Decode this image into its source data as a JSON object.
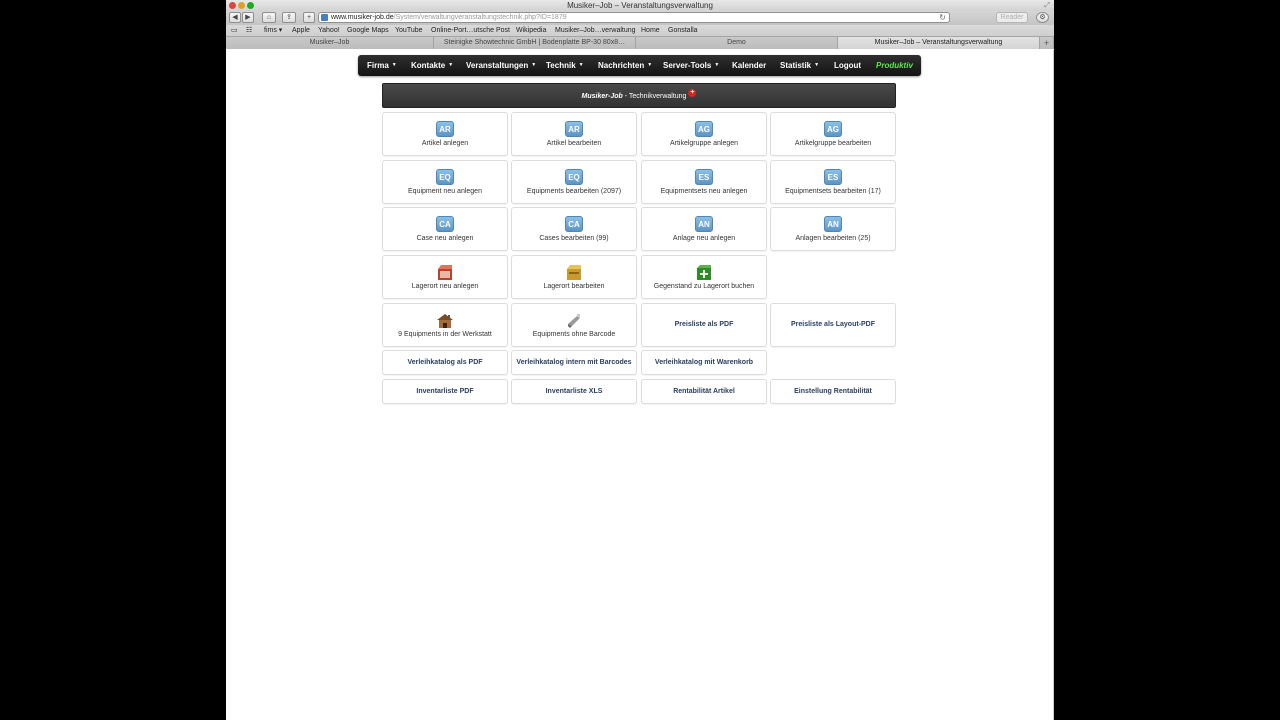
{
  "window": {
    "title": "Musiker–Job – Veranstaltungsverwaltung"
  },
  "toolbar": {
    "url_host": "www.musiker-job.de",
    "url_path": "/System/verwaltungveranstaltungstechnik.php?ID=1879",
    "reader_label": "Reader"
  },
  "bookmarks": [
    "fims ▾",
    "Apple",
    "Yahoo!",
    "Google Maps",
    "YouTube",
    "Online-Port…utsche Post",
    "Wikipedia",
    "Musiker–Job…verwaltung",
    "Home",
    "Gonstalla"
  ],
  "tabs": [
    {
      "label": "Musiker–Job"
    },
    {
      "label": "Steinigke Showtechnic GmbH | Bodenplatte BP-30 80x8…"
    },
    {
      "label": "Demo"
    },
    {
      "label": "Musiker–Job – Veranstaltungsverwaltung"
    }
  ],
  "nav": {
    "items": [
      "Firma",
      "Kontakte",
      "Veranstaltungen",
      "Technik",
      "Nachrichten",
      "Server-Tools",
      "Kalender",
      "Statistik",
      "Logout"
    ],
    "productive": "Produktiv"
  },
  "header": {
    "brand": "Musiker-Job",
    "title": " - Technikverwaltung",
    "plus": "+"
  },
  "tiles": [
    {
      "badge": "AR",
      "label": "Artikel anlegen"
    },
    {
      "badge": "AR",
      "label": "Artikel bearbeiten"
    },
    {
      "badge": "AG",
      "label": "Artikelgruppe anlegen"
    },
    {
      "badge": "AG",
      "label": "Artikelgruppe bearbeiten"
    },
    {
      "badge": "EQ",
      "label": "Equipment neu anlegen"
    },
    {
      "badge": "EQ",
      "label": "Equipments bearbeiten (2097)"
    },
    {
      "badge": "ES",
      "label": "Equipmentsets neu anlegen"
    },
    {
      "badge": "ES",
      "label": "Equipmentsets bearbeiten (17)"
    },
    {
      "badge": "CA",
      "label": "Case neu anlegen"
    },
    {
      "badge": "CA",
      "label": "Cases bearbeiten (99)"
    },
    {
      "badge": "AN",
      "label": "Anlage neu anlegen"
    },
    {
      "badge": "AN",
      "label": "Anlagen bearbeiten (25)"
    },
    {
      "icon": "red-box-icon",
      "label": "Lagerort neu anlegen"
    },
    {
      "icon": "yellow-box-icon",
      "label": "Lagerort bearbeiten"
    },
    {
      "icon": "green-box-icon",
      "label": "Gegenstand zu Lagerort buchen"
    },
    {
      "icon": "workshop-icon",
      "label": "9 Equipments in der Werkstatt"
    },
    {
      "icon": "barcode-scanner-icon",
      "label": "Equipments ohne Barcode"
    },
    {
      "label": "Preisliste als PDF"
    },
    {
      "label": "Preisliste als Layout-PDF"
    },
    {
      "label": "Verleihkatalog als PDF"
    },
    {
      "label": "Verleihkatalog intern mit Barcodes"
    },
    {
      "label": "Verleihkatalog mit Warenkorb"
    },
    {
      "label": "Inventarliste PDF"
    },
    {
      "label": "Inventarliste XLS"
    },
    {
      "label": "Rentabilität Artikel"
    },
    {
      "label": "Einstellung Rentabilität"
    }
  ]
}
